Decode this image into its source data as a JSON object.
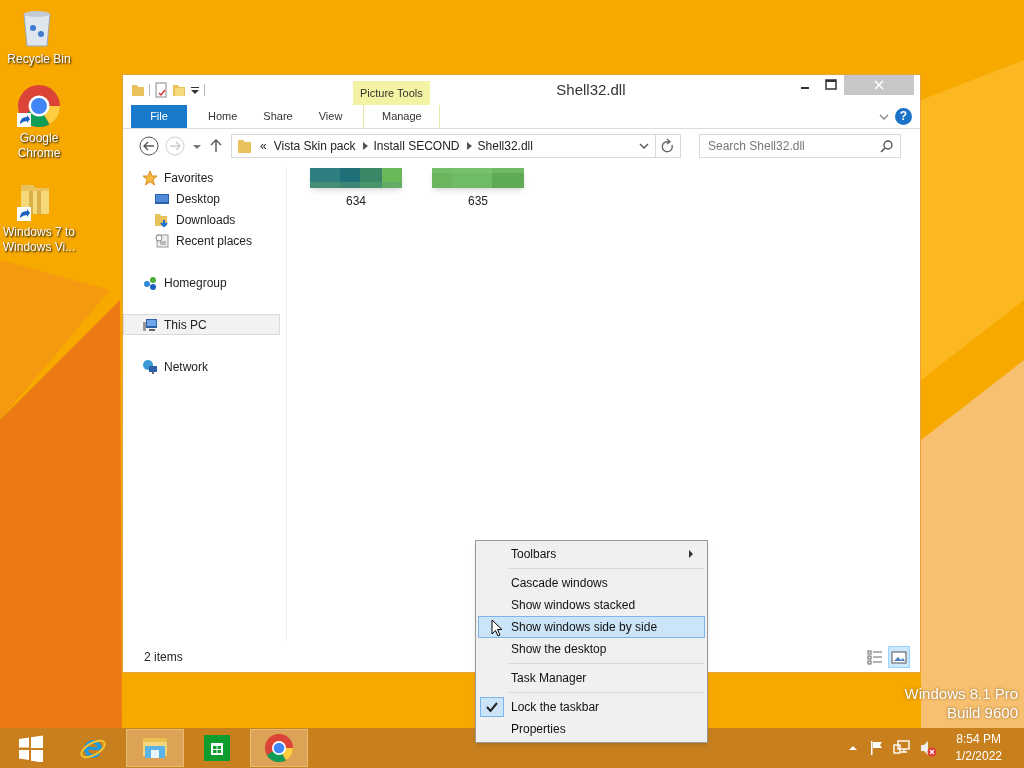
{
  "desktop_icons": [
    {
      "label": "Recycle Bin",
      "kind": "recycle",
      "shortcut": false
    },
    {
      "label": "Google Chrome",
      "kind": "chrome",
      "shortcut": true
    },
    {
      "label": "Windows 7 to Windows Vi...",
      "kind": "folder",
      "shortcut": true
    }
  ],
  "window": {
    "title": "Shell32.dll",
    "context_tab": "Picture Tools",
    "help_glyph": "?",
    "ribbon_tabs": [
      {
        "label": "File",
        "kind": "file"
      },
      {
        "label": "Home",
        "kind": "tab"
      },
      {
        "label": "Share",
        "kind": "tab"
      },
      {
        "label": "View",
        "kind": "tab"
      },
      {
        "label": "Manage",
        "kind": "contextual"
      }
    ],
    "address": {
      "prefix": "«",
      "path": [
        "Vista Skin pack",
        "Install SECOND",
        "Shell32.dll"
      ]
    },
    "search": {
      "placeholder": "Search Shell32.dll"
    },
    "navigation": [
      {
        "label": "Favorites",
        "kind": "star",
        "selected": false,
        "children": [
          {
            "label": "Desktop",
            "kind": "desktop",
            "selected": false
          },
          {
            "label": "Downloads",
            "kind": "downloads",
            "selected": false
          },
          {
            "label": "Recent places",
            "kind": "recent",
            "selected": false
          }
        ]
      },
      {
        "label": "Homegroup",
        "kind": "homegroup",
        "selected": false
      },
      {
        "label": "This PC",
        "kind": "pc",
        "selected": true
      },
      {
        "label": "Network",
        "kind": "network",
        "selected": false
      }
    ],
    "files": [
      {
        "name": "634",
        "kind": "picture"
      },
      {
        "name": "635",
        "kind": "picture"
      }
    ],
    "status_bar": {
      "text": "2 items",
      "views": [
        {
          "kind": "details",
          "selected": false
        },
        {
          "kind": "large",
          "selected": true
        }
      ]
    }
  },
  "context_menu": [
    {
      "kind": "item",
      "label": "Toolbars",
      "submenu": true,
      "checked": false,
      "selected": false
    },
    {
      "kind": "separator"
    },
    {
      "kind": "item",
      "label": "Cascade windows",
      "submenu": false,
      "checked": false,
      "selected": false
    },
    {
      "kind": "item",
      "label": "Show windows stacked",
      "submenu": false,
      "checked": false,
      "selected": false
    },
    {
      "kind": "item",
      "label": "Show windows side by side",
      "submenu": false,
      "checked": false,
      "selected": true
    },
    {
      "kind": "item",
      "label": "Show the desktop",
      "submenu": false,
      "checked": false,
      "selected": false
    },
    {
      "kind": "separator"
    },
    {
      "kind": "item",
      "label": "Task Manager",
      "submenu": false,
      "checked": false,
      "selected": false
    },
    {
      "kind": "separator"
    },
    {
      "kind": "item",
      "label": "Lock the taskbar",
      "submenu": false,
      "checked": true,
      "selected": false
    },
    {
      "kind": "item",
      "label": "Properties",
      "submenu": false,
      "checked": false,
      "selected": false
    }
  ],
  "desktop_watermark": [
    "Windows 8.1 Pro",
    "Build 9600"
  ],
  "taskbar": {
    "apps": [
      {
        "kind": "start",
        "active": false
      },
      {
        "kind": "ie",
        "active": false
      },
      {
        "kind": "explorer",
        "active": true
      },
      {
        "kind": "store",
        "active": false
      },
      {
        "kind": "chrome",
        "active": true
      }
    ],
    "clock": {
      "time": "8:54 PM",
      "date": "1/2/2022"
    }
  }
}
